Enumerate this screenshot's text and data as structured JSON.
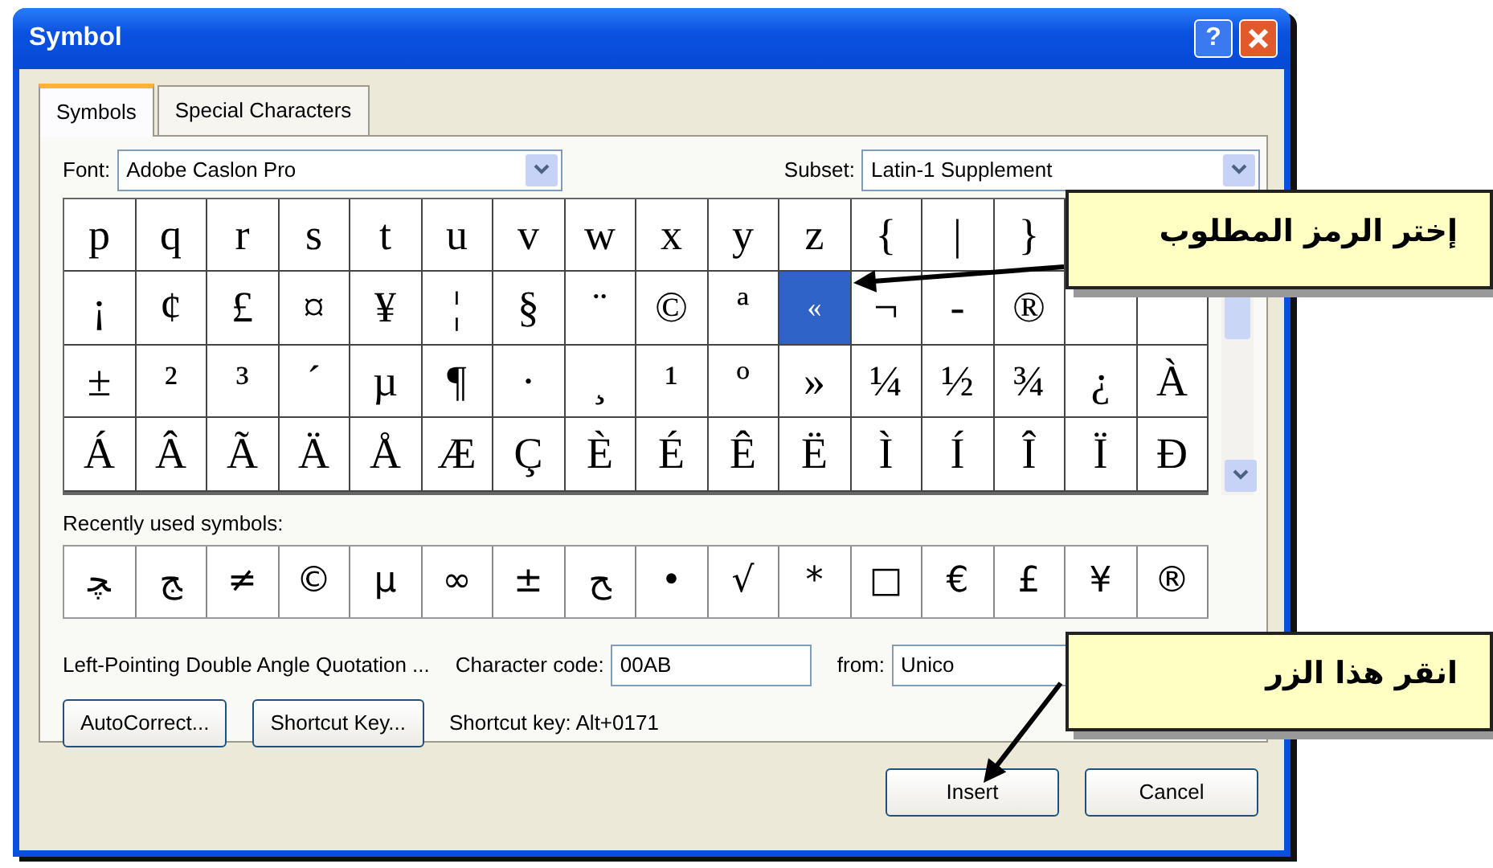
{
  "window": {
    "title": "Symbol",
    "help": "?"
  },
  "tabs": [
    {
      "label": "Symbols",
      "selected": true
    },
    {
      "label": "Special Characters",
      "selected": false
    }
  ],
  "font": {
    "label": "Font:",
    "value": "Adobe Caslon Pro"
  },
  "subset": {
    "label": "Subset:",
    "value": "Latin-1 Supplement"
  },
  "symbol_grid": {
    "rows": [
      {
        "cells": [
          {
            "char": "p",
            "selected": false
          },
          {
            "char": "q",
            "selected": false
          },
          {
            "char": "r",
            "selected": false
          },
          {
            "char": "s",
            "selected": false
          },
          {
            "char": "t",
            "selected": false
          },
          {
            "char": "u",
            "selected": false
          },
          {
            "char": "v",
            "selected": false
          },
          {
            "char": "w",
            "selected": false
          },
          {
            "char": "x",
            "selected": false
          },
          {
            "char": "y",
            "selected": false
          },
          {
            "char": "z",
            "selected": false
          },
          {
            "char": "{",
            "selected": false
          },
          {
            "char": "|",
            "selected": false
          },
          {
            "char": "}",
            "selected": false
          }
        ]
      },
      {
        "cells": [
          {
            "char": "¡",
            "selected": false
          },
          {
            "char": "¢",
            "selected": false
          },
          {
            "char": "£",
            "selected": false
          },
          {
            "char": "¤",
            "selected": false
          },
          {
            "char": "¥",
            "selected": false
          },
          {
            "char": "¦",
            "selected": false
          },
          {
            "char": "§",
            "selected": false
          },
          {
            "char": "¨",
            "selected": false
          },
          {
            "char": "©",
            "selected": false
          },
          {
            "char": "ª",
            "selected": false
          },
          {
            "char": "«",
            "selected": true
          },
          {
            "char": "¬",
            "selected": false
          },
          {
            "char": "-",
            "selected": false
          },
          {
            "char": "®",
            "selected": false
          }
        ]
      },
      {
        "cells": [
          {
            "char": "±",
            "selected": false
          },
          {
            "char": "²",
            "selected": false
          },
          {
            "char": "³",
            "selected": false
          },
          {
            "char": "´",
            "selected": false
          },
          {
            "char": "µ",
            "selected": false
          },
          {
            "char": "¶",
            "selected": false
          },
          {
            "char": "·",
            "selected": false
          },
          {
            "char": "¸",
            "selected": false
          },
          {
            "char": "¹",
            "selected": false
          },
          {
            "char": "º",
            "selected": false
          },
          {
            "char": "»",
            "selected": false
          },
          {
            "char": "¼",
            "selected": false
          },
          {
            "char": "½",
            "selected": false
          },
          {
            "char": "¾",
            "selected": false
          },
          {
            "char": "¿",
            "selected": false
          },
          {
            "char": "À",
            "selected": false
          }
        ]
      },
      {
        "cells": [
          {
            "char": "Á",
            "selected": false
          },
          {
            "char": "Â",
            "selected": false
          },
          {
            "char": "Ã",
            "selected": false
          },
          {
            "char": "Ä",
            "selected": false
          },
          {
            "char": "Å",
            "selected": false
          },
          {
            "char": "Æ",
            "selected": false
          },
          {
            "char": "Ç",
            "selected": false
          },
          {
            "char": "È",
            "selected": false
          },
          {
            "char": "É",
            "selected": false
          },
          {
            "char": "Ê",
            "selected": false
          },
          {
            "char": "Ë",
            "selected": false
          },
          {
            "char": "Ì",
            "selected": false
          },
          {
            "char": "Í",
            "selected": false
          },
          {
            "char": "Î",
            "selected": false
          },
          {
            "char": "Ï",
            "selected": false
          },
          {
            "char": "Ð",
            "selected": false
          }
        ]
      }
    ]
  },
  "recent": {
    "label": "Recently used symbols:",
    "symbols": [
      "ﭽ",
      "ﺞ",
      "≠",
      "©",
      "µ",
      "∞",
      "±",
      "ﺢ",
      "•",
      "√",
      "*",
      "□",
      "€",
      "£",
      "¥",
      "®"
    ]
  },
  "description": "Left-Pointing Double Angle Quotation ...",
  "character_code": {
    "label": "Character code:",
    "value": "00AB"
  },
  "from": {
    "label": "from:",
    "value": "Unico"
  },
  "buttons": [
    {
      "label": "AutoCorrect..."
    },
    {
      "label": "Shortcut Key..."
    }
  ],
  "shortcut_text": "Shortcut key: Alt+0171",
  "footer_buttons": [
    {
      "label": "Insert"
    },
    {
      "label": "Cancel"
    }
  ],
  "callouts": [
    {
      "text": "إختر الرمز المطلوب"
    },
    {
      "text": "انقر هذا الزر"
    }
  ]
}
